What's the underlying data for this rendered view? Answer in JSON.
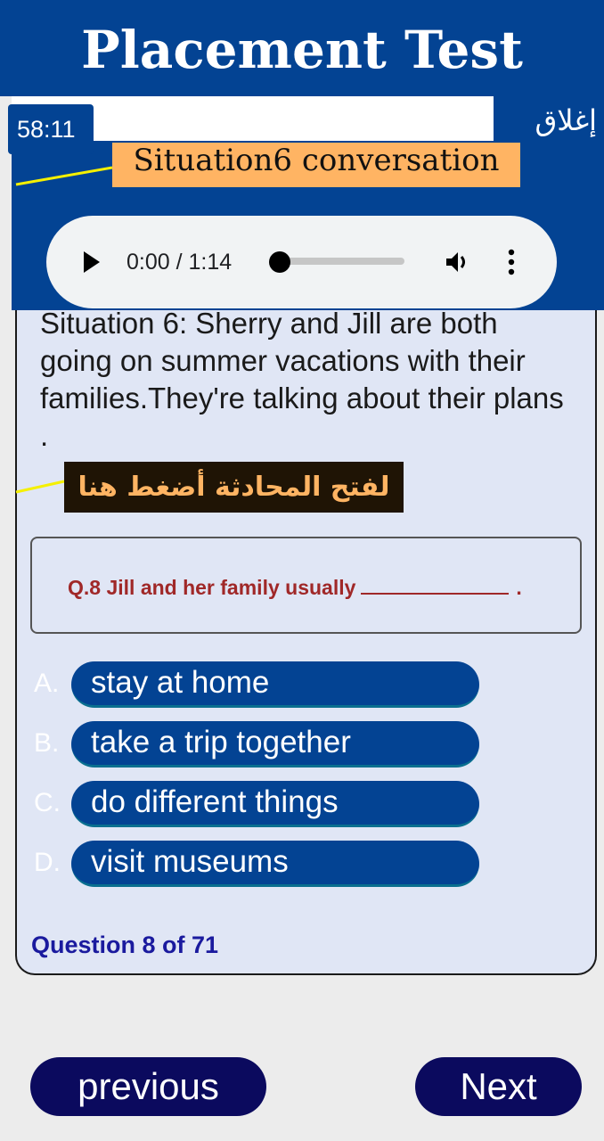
{
  "header": {
    "title": "Placement Test"
  },
  "toolbar": {
    "timer": "58:11",
    "close_label": "إغلاق"
  },
  "situation": {
    "label": "Situation6 conversation",
    "description": "Situation 6: Sherry and Jill are both going on summer vacations with their families.They're talking about their plans ."
  },
  "audio": {
    "time": "0:00 / 1:14",
    "progress_fraction": 0
  },
  "conversation_button": "لفتح المحادثة أضغط هنا",
  "question": {
    "text": "Q.8 Jill and her family usually",
    "end": "."
  },
  "options": [
    {
      "letter": "A.",
      "text": "stay at home"
    },
    {
      "letter": "B.",
      "text": "take a trip together"
    },
    {
      "letter": "C.",
      "text": "do different things"
    },
    {
      "letter": "D.",
      "text": "visit museums"
    }
  ],
  "progress": "Question 8 of 71",
  "nav": {
    "previous": "previous",
    "next": "Next"
  },
  "colors": {
    "primary": "#034393",
    "card": "#e0e6f5",
    "accent": "#ffb463",
    "question": "#a02828",
    "nav": "#0b0a5e",
    "pointer": "#f5f000"
  }
}
